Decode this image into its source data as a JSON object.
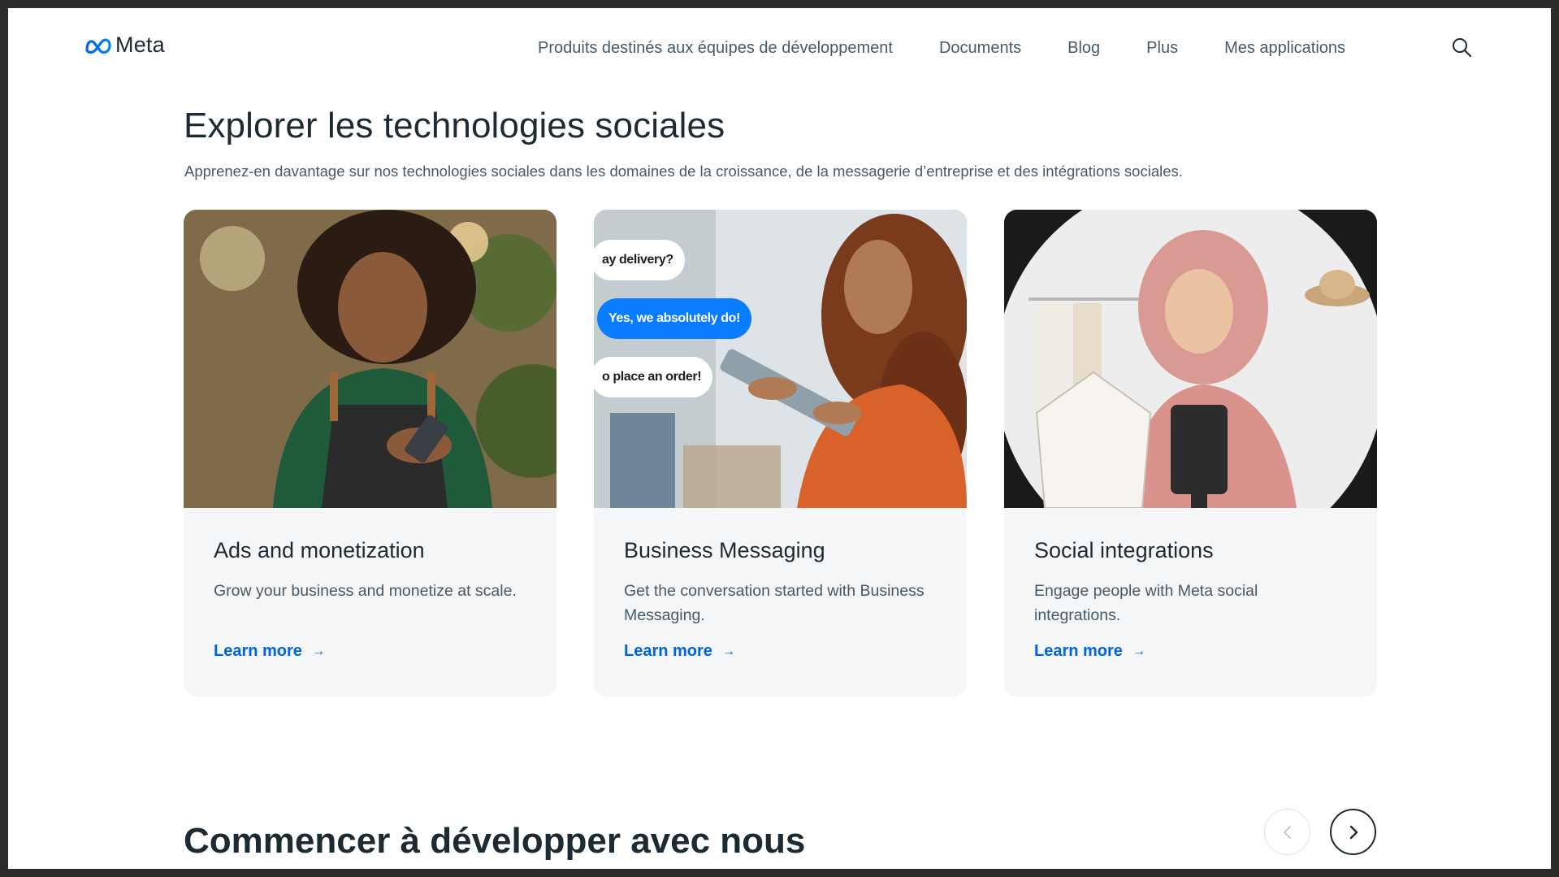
{
  "header": {
    "logo_text": "Meta",
    "nav": [
      {
        "label": "Produits destinés aux équipes de développement"
      },
      {
        "label": "Documents"
      },
      {
        "label": "Blog"
      },
      {
        "label": "Plus"
      },
      {
        "label": "Mes applications"
      }
    ],
    "search_icon": "search-icon"
  },
  "explore": {
    "title": "Explorer les technologies sociales",
    "subtitle": "Apprenez-en davantage sur nos technologies sociales dans les domaines de la croissance, de la messagerie d’entreprise et des intégrations sociales.",
    "cards": [
      {
        "title": "Ads and monetization",
        "description": "Grow your business and monetize at scale.",
        "link": "Learn more"
      },
      {
        "title": "Business Messaging",
        "description": "Get the conversation started with Business Messaging.",
        "link": "Learn more",
        "bubbles": [
          "ay delivery?",
          "Yes, we absolutely do!",
          "o place an order!"
        ]
      },
      {
        "title": "Social integrations",
        "description": "Engage people with Meta social integrations.",
        "link": "Learn more"
      }
    ]
  },
  "build": {
    "title": "Commencer à développer avec nous",
    "prev_icon": "chevron-left-icon",
    "next_icon": "chevron-right-icon"
  },
  "colors": {
    "link": "#0064e0",
    "heading": "#1c2b33",
    "body_text": "#465a69",
    "card_bg": "#f5f6f7",
    "bubble_blue": "#0a7cff"
  }
}
